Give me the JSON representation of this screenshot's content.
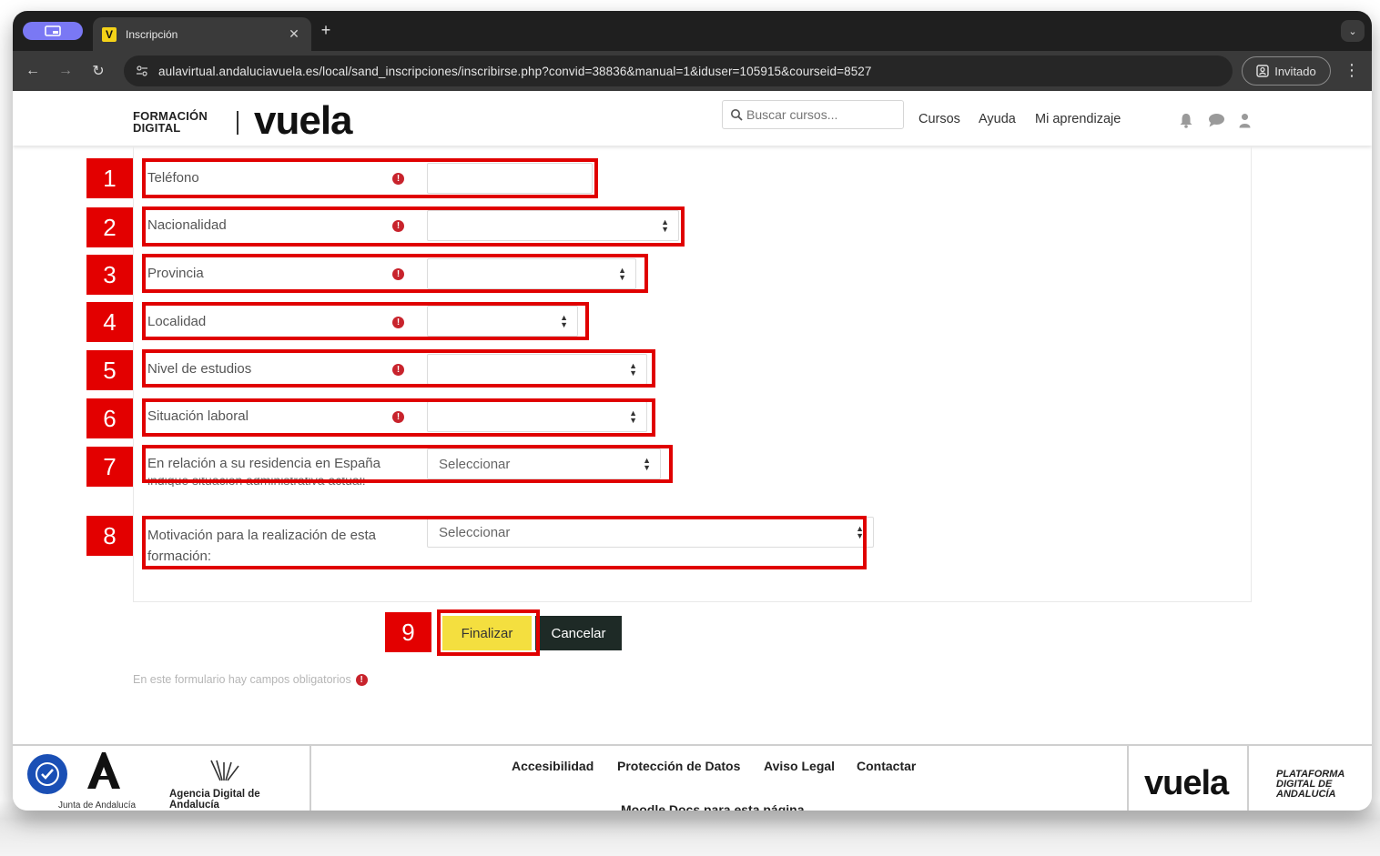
{
  "browser": {
    "tab_title": "Inscripción",
    "favicon_letter": "V",
    "url": "aulavirtual.andaluciavuela.es/local/sand_inscripciones/inscribirse.php?convid=38836&manual=1&iduser=105915&courseid=8527",
    "profile_label": "Invitado"
  },
  "site": {
    "brand_line1": "FORMACIÓN",
    "brand_line2": "DIGITAL",
    "brand_logo": "vuela",
    "search_placeholder": "Buscar cursos...",
    "nav": [
      "Cursos",
      "Ayuda",
      "Mi aprendizaje"
    ]
  },
  "form": {
    "fields": [
      {
        "label": "Teléfono",
        "value": ""
      },
      {
        "label": "Nacionalidad",
        "value": ""
      },
      {
        "label": "Provincia",
        "value": ""
      },
      {
        "label": "Localidad",
        "value": ""
      },
      {
        "label": "Nivel de estudios",
        "value": ""
      },
      {
        "label": "Situación laboral",
        "value": ""
      },
      {
        "label": "En relación a su residencia en España",
        "value": "Seleccionar"
      },
      {
        "label_line1": "Motivación para la realización de esta",
        "label_line2": "formación:",
        "value": "Seleccionar"
      }
    ],
    "residencia_note": "indique situación administrativa actual:",
    "submit_label": "Finalizar",
    "cancel_label": "Cancelar",
    "required_note": "En este formulario hay campos obligatorios"
  },
  "annotations": [
    "1",
    "2",
    "3",
    "4",
    "5",
    "6",
    "7",
    "8",
    "9"
  ],
  "footer": {
    "links": [
      "Accesibilidad",
      "Protección de Datos",
      "Aviso Legal",
      "Contactar"
    ],
    "moodle_docs": "Moodle Docs para esta página",
    "junta": "Junta de Andalucía",
    "agencia": "Agencia Digital de Andalucía",
    "brand": "vuela",
    "plataforma": "PLATAFORMA DIGITAL DE ANDALUCÍA"
  },
  "colors": {
    "accent_yellow": "#f4df3f",
    "annotation_red": "#e30000",
    "required_red": "#c8232c",
    "cancel_dark": "#1e2a26"
  }
}
